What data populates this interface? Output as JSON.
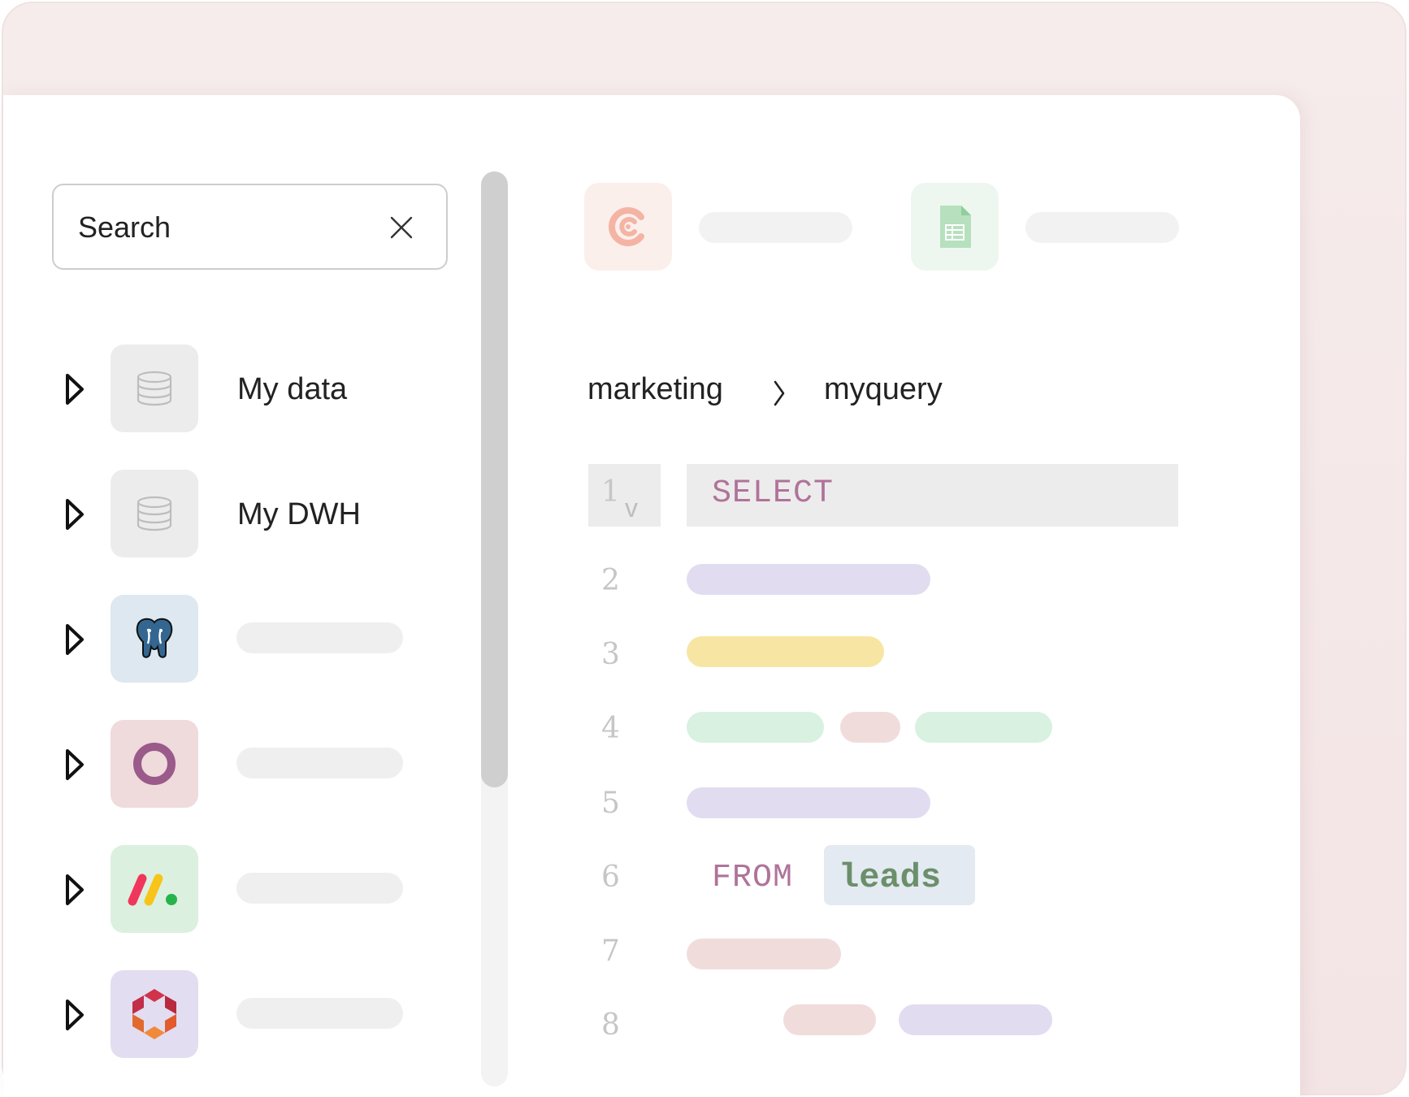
{
  "search": {
    "placeholder": "Search"
  },
  "tree": [
    {
      "label": "My data",
      "icon": "database-icon",
      "tile_color": "#ececec"
    },
    {
      "label": "My DWH",
      "icon": "database-icon",
      "tile_color": "#ececec"
    },
    {
      "label": "",
      "icon": "postgresql-icon",
      "tile_color": "#dde8f0"
    },
    {
      "label": "",
      "icon": "ring-icon",
      "tile_color": "#efdadc"
    },
    {
      "label": "",
      "icon": "monday-icon",
      "tile_color": "#dcf0e0"
    },
    {
      "label": "",
      "icon": "hexagon-logo-icon",
      "tile_color": "#e2ddf0"
    }
  ],
  "connectors": [
    {
      "icon": "circle-c-logo-icon",
      "tile_color": "#fbefec"
    },
    {
      "icon": "spreadsheet-icon",
      "tile_color": "#eef7ef"
    }
  ],
  "breadcrumb": {
    "folder": "marketing",
    "query": "myquery"
  },
  "editor": {
    "line_numbers": [
      "1",
      "2",
      "3",
      "4",
      "5",
      "6",
      "7",
      "8"
    ],
    "fold_marker": "v",
    "select_keyword": "SELECT",
    "from_keyword": "FROM",
    "table_name": "leads",
    "colors": {
      "keyword": "#b0739a",
      "table": "#6b8f6b",
      "purple": "#e2dcf1",
      "yellow": "#f7e6a3",
      "green": "#d8f1e1",
      "pink": "#f1dcdc"
    }
  }
}
